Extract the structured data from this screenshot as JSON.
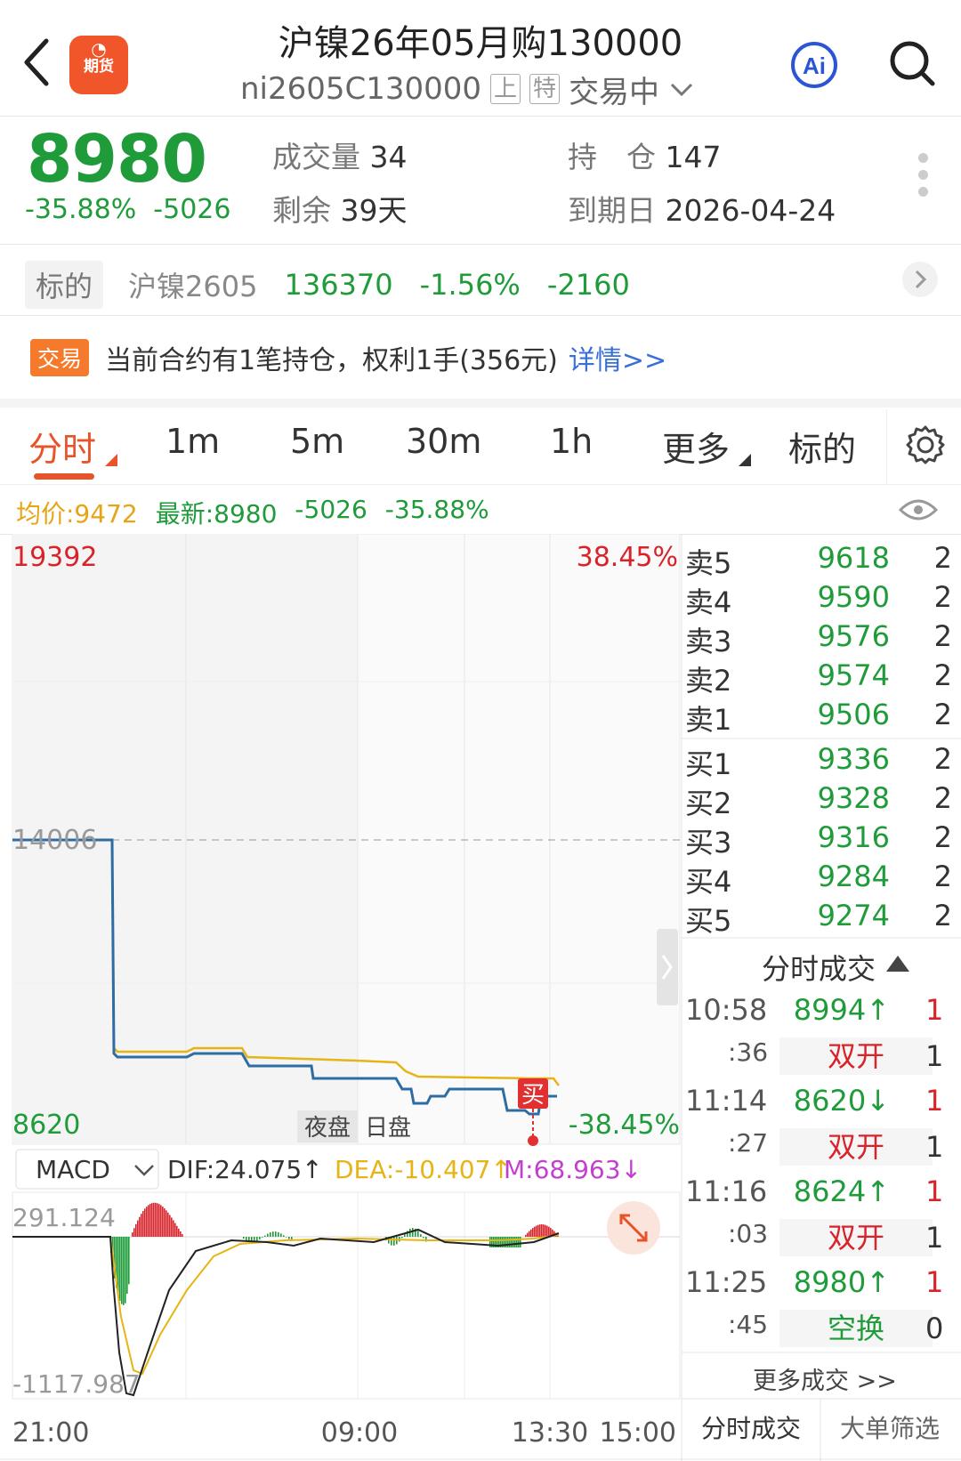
{
  "header": {
    "title": "沪镍26年05月购130000",
    "code": "ni2605C130000",
    "tag_shang": "上",
    "tag_te": "特",
    "status": "交易中",
    "logo_text": "期货",
    "ai_label": "Ai"
  },
  "quote": {
    "price": "8980",
    "change_pct": "-35.88%",
    "change": "-5026",
    "volume_label": "成交量",
    "volume": "34",
    "oi_label": "持　仓",
    "oi": "147",
    "remain_label": "剩余",
    "remain": "39天",
    "expiry_label": "到期日",
    "expiry": "2026-04-24"
  },
  "underlying": {
    "tag": "标的",
    "name": "沪镍2605",
    "price": "136370",
    "pct": "-1.56%",
    "change": "-2160"
  },
  "notice": {
    "tag": "交易",
    "text": "当前合约有1笔持仓，权利1手(356元)",
    "link": "详情>>"
  },
  "tabs": [
    {
      "label": "分时"
    },
    {
      "label": "1m"
    },
    {
      "label": "5m"
    },
    {
      "label": "30m"
    },
    {
      "label": "1h"
    },
    {
      "label": "更多"
    },
    {
      "label": "标的"
    }
  ],
  "info": {
    "avg": "均价:9472",
    "latest": "最新:8980",
    "chg": "-5026",
    "pct": "-35.88%"
  },
  "chart_labels": {
    "ymax": "19392",
    "ymid": "14006",
    "ymin": "8620",
    "pmax": "38.45%",
    "pmin": "-38.45%",
    "session_night": "夜盘",
    "session_day": "日盘",
    "buy_marker": "买",
    "x0": "21:00",
    "x1": "09:00",
    "x2": "13:30",
    "x3": "15:00"
  },
  "macd": {
    "selector": "MACD",
    "dif": "DIF:24.075↑",
    "dea": "DEA:-10.407↑",
    "m": "M:68.963↓",
    "ymax": "291.124",
    "ymin": "-1117.987"
  },
  "colors": {
    "up": "#d8232a",
    "down": "#1f9b3a",
    "price_line": "#2e6da4",
    "avg_line": "#e7b416",
    "accent": "#e8532a",
    "macd_m": "#c23fd0"
  },
  "order_book": {
    "asks": [
      {
        "label": "卖5",
        "price": "9618",
        "vol": "2"
      },
      {
        "label": "卖4",
        "price": "9590",
        "vol": "2"
      },
      {
        "label": "卖3",
        "price": "9576",
        "vol": "2"
      },
      {
        "label": "卖2",
        "price": "9574",
        "vol": "2"
      },
      {
        "label": "卖1",
        "price": "9506",
        "vol": "2"
      }
    ],
    "bids": [
      {
        "label": "买1",
        "price": "9336",
        "vol": "2"
      },
      {
        "label": "买2",
        "price": "9328",
        "vol": "2"
      },
      {
        "label": "买3",
        "price": "9316",
        "vol": "2"
      },
      {
        "label": "买4",
        "price": "9284",
        "vol": "2"
      },
      {
        "label": "买5",
        "price": "9274",
        "vol": "2"
      }
    ]
  },
  "trades": {
    "header": "分时成交",
    "items": [
      {
        "time": "10:58",
        "sec": ":36",
        "price": "8994↑",
        "vol": "1",
        "type": "双开",
        "type_vol": "1"
      },
      {
        "time": "11:14",
        "sec": ":27",
        "price": "8620↓",
        "vol": "1",
        "type": "双开",
        "type_vol": "1"
      },
      {
        "time": "11:16",
        "sec": ":03",
        "price": "8624↑",
        "vol": "1",
        "type": "双开",
        "type_vol": "1"
      },
      {
        "time": "11:25",
        "sec": ":45",
        "price": "8980↑",
        "vol": "1",
        "type": "空换",
        "type_vol": "0"
      }
    ],
    "more": "更多成交 >>"
  },
  "bottom_tabs": {
    "left": "分时成交",
    "right": "大单筛选"
  }
}
